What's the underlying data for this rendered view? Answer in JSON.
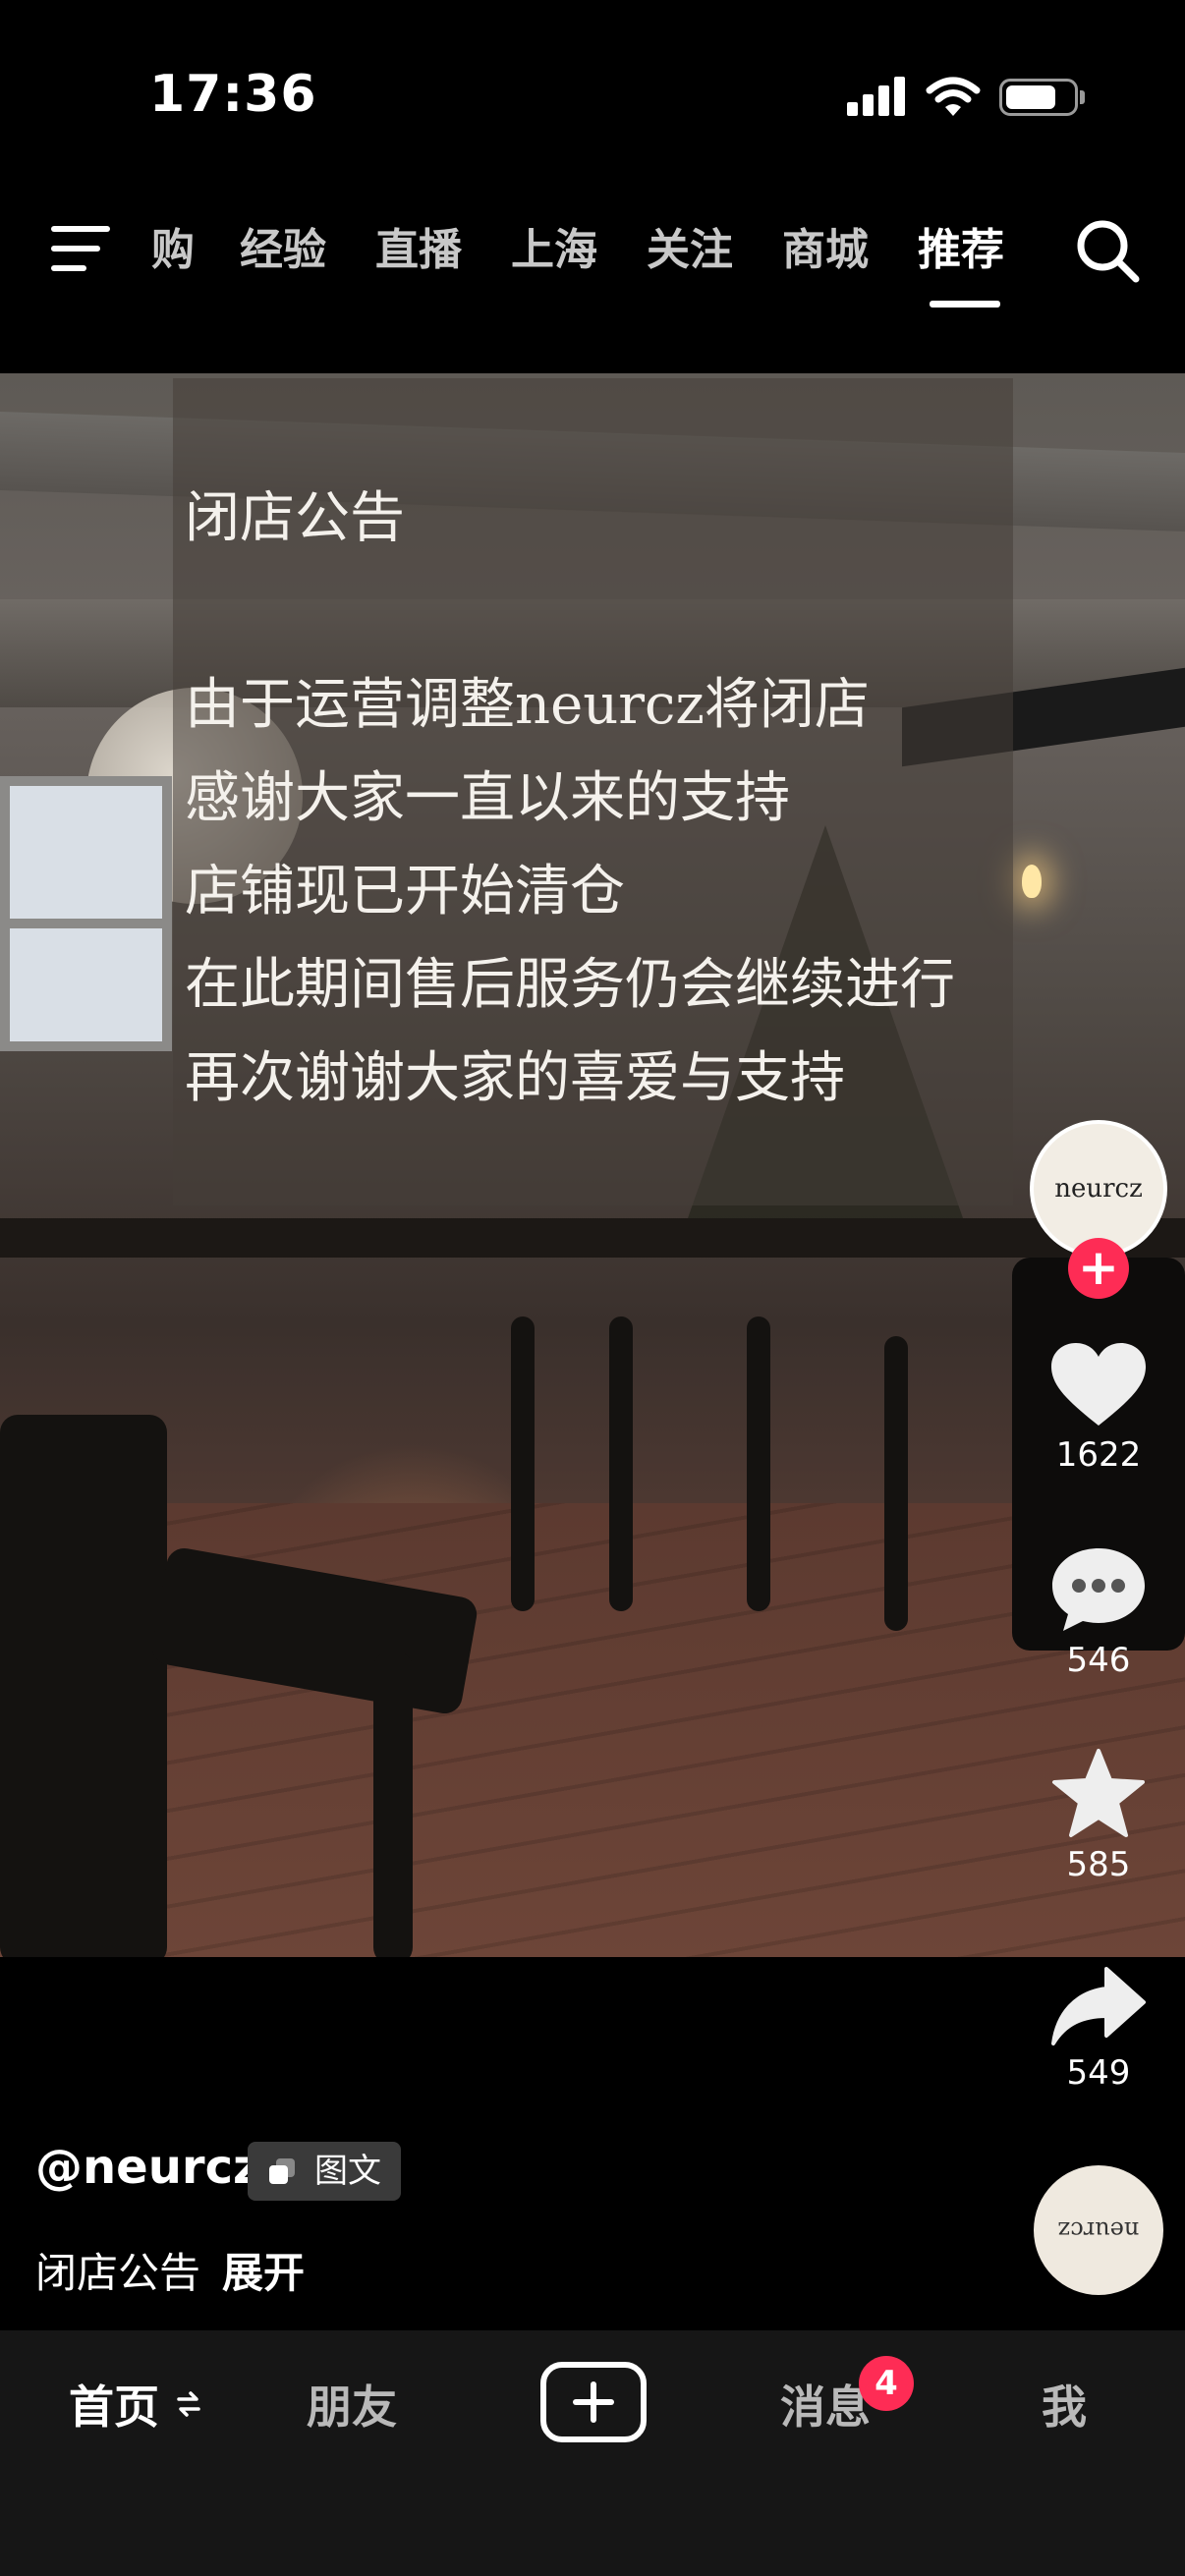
{
  "status_bar": {
    "time": "17:36"
  },
  "top_nav": {
    "tabs": [
      {
        "label": "购"
      },
      {
        "label": "经验"
      },
      {
        "label": "直播"
      },
      {
        "label": "上海"
      },
      {
        "label": "关注"
      },
      {
        "label": "商城"
      },
      {
        "label": "推荐",
        "active": true
      }
    ]
  },
  "post": {
    "notice_lines": [
      "闭店公告",
      "由于运营调整neurcz将闭店",
      "感谢大家一直以来的支持",
      "店铺现已开始清仓",
      "在此期间售后服务仍会继续进行",
      "再次谢谢大家的喜爱与支持"
    ],
    "author": "@neurcz",
    "type_badge": "图文",
    "caption": "闭店公告",
    "expand_label": "展开",
    "avatar_text": "neurcz",
    "disc_text": "neurcz"
  },
  "actions": {
    "likes": "1622",
    "comments": "546",
    "favorites": "585",
    "shares": "549"
  },
  "bottom_tabs": {
    "home": "首页",
    "friends": "朋友",
    "messages": "消息",
    "messages_badge": "4",
    "me": "我"
  },
  "colors": {
    "accent": "#fe2c55",
    "background": "#000000",
    "tab_bar": "#161616"
  },
  "icons": [
    "menu-icon",
    "search-icon",
    "heart-icon",
    "comment-icon",
    "star-icon",
    "share-icon",
    "plus-icon",
    "swap-icon",
    "image-text-icon"
  ]
}
